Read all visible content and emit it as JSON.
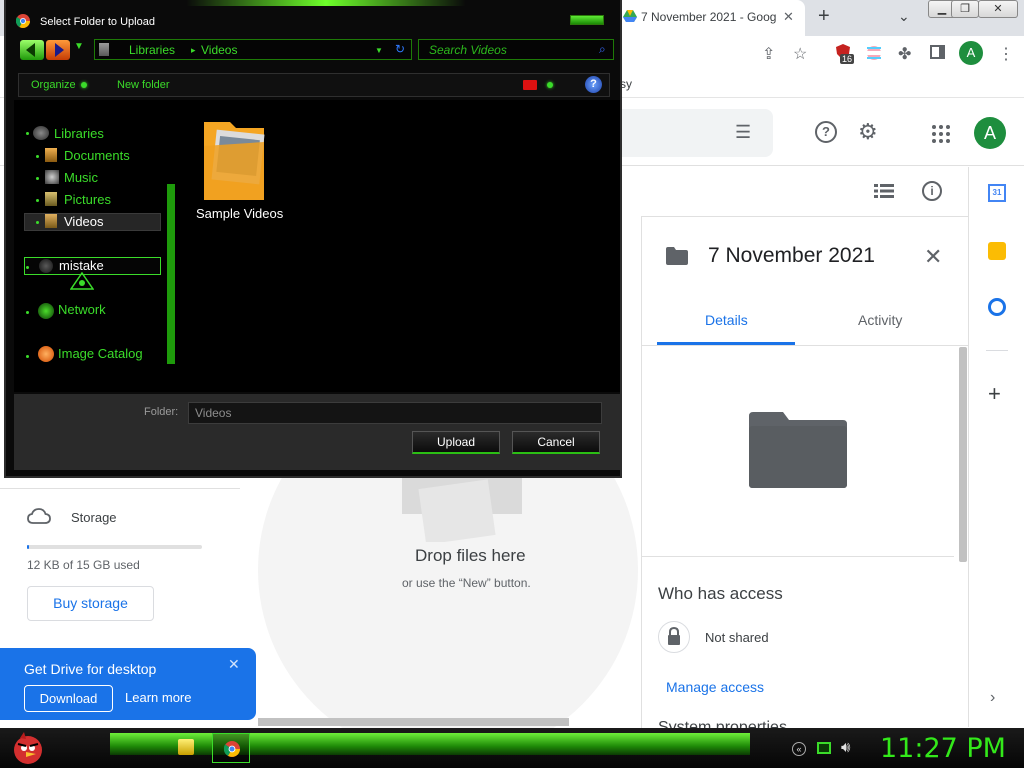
{
  "browser": {
    "tab_title": "7 November 2021 - Goog",
    "tab_close": "✕",
    "new_tab": "+",
    "bookmark_fragment": "sy",
    "extension_badge": "16",
    "profile_initial": "A"
  },
  "drive": {
    "profile_initial": "A",
    "details_panel": {
      "title": "7 November 2021",
      "tabs": [
        "Details",
        "Activity"
      ],
      "active_tab": "Details",
      "who_has_access": "Who has access",
      "not_shared": "Not shared",
      "manage_access": "Manage access",
      "system_properties": "System properties"
    },
    "drop_zone": {
      "title": "Drop files here",
      "subtitle": "or use the “New” button."
    },
    "storage": {
      "label": "Storage",
      "used_text": "12 KB of 15 GB used",
      "used_fraction": 0.001,
      "buy_button": "Buy storage"
    },
    "promo": {
      "title": "Get Drive for desktop",
      "download": "Download",
      "learn_more": "Learn more",
      "close": "✕"
    },
    "side_rail": {
      "calendar_day": "31"
    }
  },
  "dialog": {
    "title": "Select Folder to Upload",
    "path": [
      "Libraries",
      "Videos"
    ],
    "search_placeholder": "Search Videos",
    "commands": {
      "organize": "Organize",
      "new_folder": "New folder",
      "help": "?"
    },
    "tree": {
      "libraries": "Libraries",
      "documents": "Documents",
      "music": "Music",
      "pictures": "Pictures",
      "videos": "Videos",
      "renaming": "mistake",
      "network": "Network",
      "image_catalog": "Image Catalog"
    },
    "selected_tree_item": "Videos",
    "content_items": [
      {
        "label": "Sample Videos"
      }
    ],
    "folder_field_label": "Folder:",
    "folder_field_value": "Videos",
    "upload_button": "Upload",
    "cancel_button": "Cancel"
  },
  "taskbar": {
    "clock": "11:27 PM"
  },
  "colors": {
    "accent_green": "#3bdc2a",
    "drive_blue": "#1a73e8",
    "clock_green": "#33e91a"
  }
}
